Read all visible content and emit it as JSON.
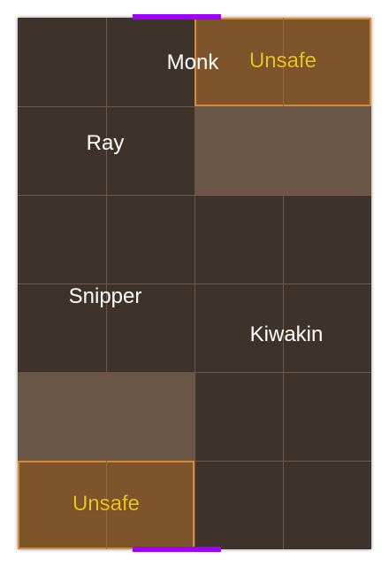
{
  "colors": {
    "board": "#3e332b",
    "grid_line": "#6b5a4e",
    "unsafe_fill": "#7e552b",
    "unsafe_border": "#d88a3a",
    "blocked_fill": "#6b5747",
    "gate": "#a000ff",
    "piece_text": "#ffffff",
    "unsafe_text": "#f0c419"
  },
  "board": {
    "columns": 4,
    "rows": 6
  },
  "zones": {
    "top_unsafe": {
      "label": "Unsafe"
    },
    "bottom_unsafe": {
      "label": "Unsafe"
    }
  },
  "pieces": {
    "monk": {
      "name": "Monk"
    },
    "ray": {
      "name": "Ray"
    },
    "snipper": {
      "name": "Snipper"
    },
    "kiwakin": {
      "name": "Kiwakin"
    }
  },
  "gates": {
    "top": {
      "icon": "exit-gate"
    },
    "bottom": {
      "icon": "entry-gate"
    }
  }
}
